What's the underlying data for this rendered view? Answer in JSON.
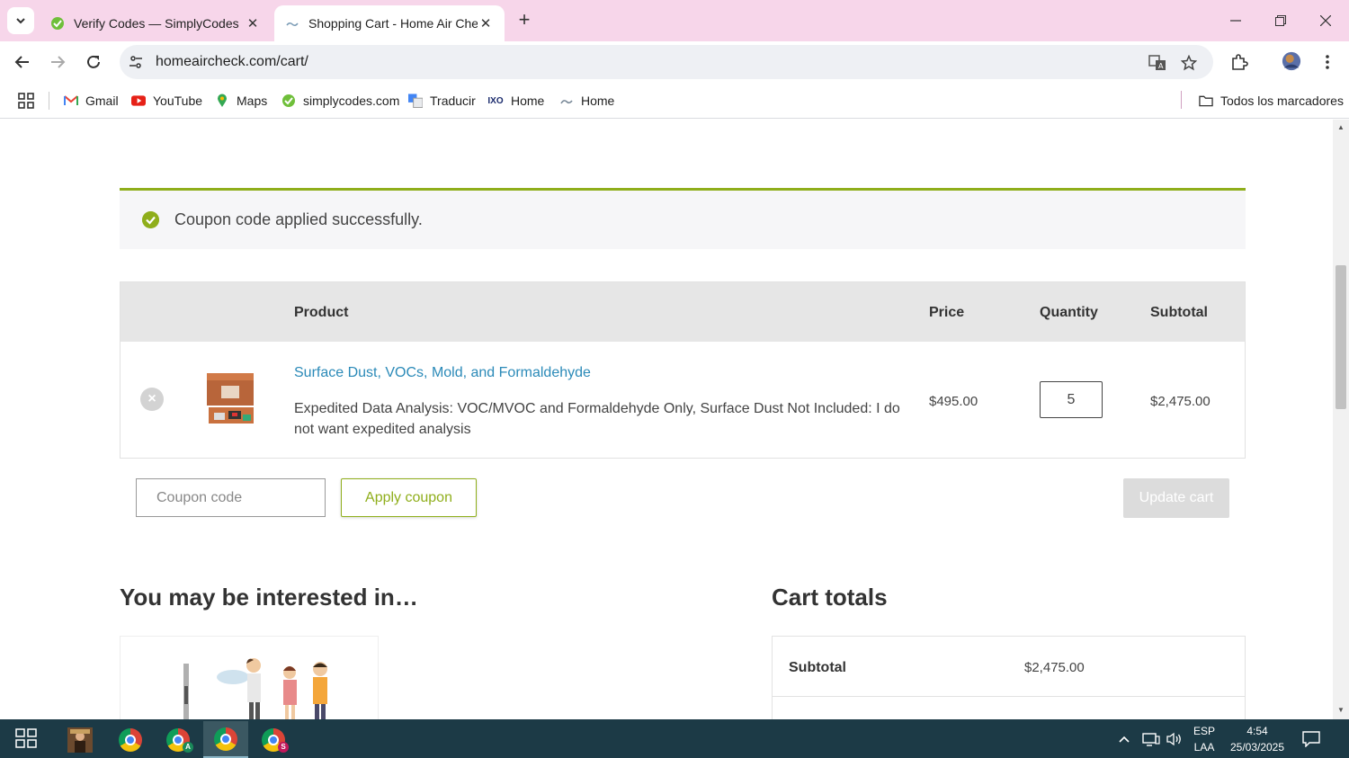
{
  "browser": {
    "tabs": [
      {
        "title": "Verify Codes — SimplyCodes",
        "active": false
      },
      {
        "title": "Shopping Cart - Home Air Chec",
        "active": true
      }
    ],
    "url": "homeaircheck.com/cart/",
    "bookmarks": [
      {
        "label": "Gmail",
        "icon": "gmail-icon"
      },
      {
        "label": "YouTube",
        "icon": "youtube-icon"
      },
      {
        "label": "Maps",
        "icon": "maps-icon"
      },
      {
        "label": "simplycodes.com",
        "icon": "simplycodes-icon"
      },
      {
        "label": "Traducir",
        "icon": "translate-icon"
      },
      {
        "label": "Home",
        "icon": "home-logo-icon"
      },
      {
        "label": "Home",
        "icon": "home-cloud-icon"
      }
    ],
    "all_bookmarks": "Todos los marcadores"
  },
  "notice": {
    "message": "Coupon code applied successfully."
  },
  "cart": {
    "headers": {
      "product": "Product",
      "price": "Price",
      "quantity": "Quantity",
      "subtotal": "Subtotal"
    },
    "item": {
      "remove": "×",
      "name": "Surface Dust, VOCs, Mold, and Formaldehyde",
      "description": "Expedited Data Analysis: VOC/MVOC and Formaldehyde Only, Surface Dust Not Included: I do not want expedited analysis",
      "price": "$495.00",
      "quantity": "5",
      "subtotal": "$2,475.00"
    },
    "coupon_placeholder": "Coupon code",
    "apply_label": "Apply coupon",
    "update_label": "Update cart"
  },
  "interested": {
    "title": "You may be interested in…"
  },
  "totals": {
    "title": "Cart totals",
    "subtotal_label": "Subtotal",
    "subtotal_value": "$2,475.00"
  },
  "taskbar": {
    "lang_line1": "ESP",
    "lang_line2": "LAA",
    "time": "4:54",
    "date": "25/03/2025"
  },
  "colors": {
    "accent_green": "#8fae1b",
    "link_blue": "#2b8ab8",
    "tab_bar_pink": "#f7d6ea",
    "taskbar": "#1c3a46"
  }
}
